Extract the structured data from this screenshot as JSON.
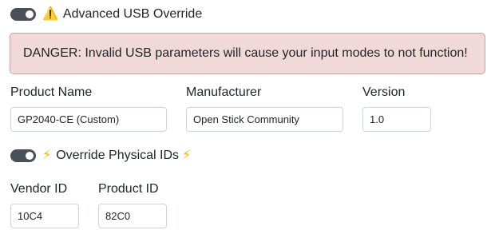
{
  "usb_override": {
    "toggle_on": true,
    "label": "Advanced USB Override",
    "icon": "warning-icon"
  },
  "alert": {
    "text": "DANGER: Invalid USB parameters will cause your input modes to not function!",
    "color_bg": "#f1d9d9",
    "color_border": "#c9a2a6"
  },
  "fields": {
    "product_name": {
      "label": "Product Name",
      "value": "GP2040-CE (Custom)"
    },
    "manufacturer": {
      "label": "Manufacturer",
      "value": "Open Stick Community"
    },
    "version": {
      "label": "Version",
      "value": "1.0"
    }
  },
  "physical_ids": {
    "toggle_on": true,
    "label": "Override Physical IDs",
    "icon": "lightning-icon"
  },
  "ids": {
    "vendor_id": {
      "label": "Vendor ID",
      "value": "10C4"
    },
    "product_id": {
      "label": "Product ID",
      "value": "82C0"
    }
  }
}
